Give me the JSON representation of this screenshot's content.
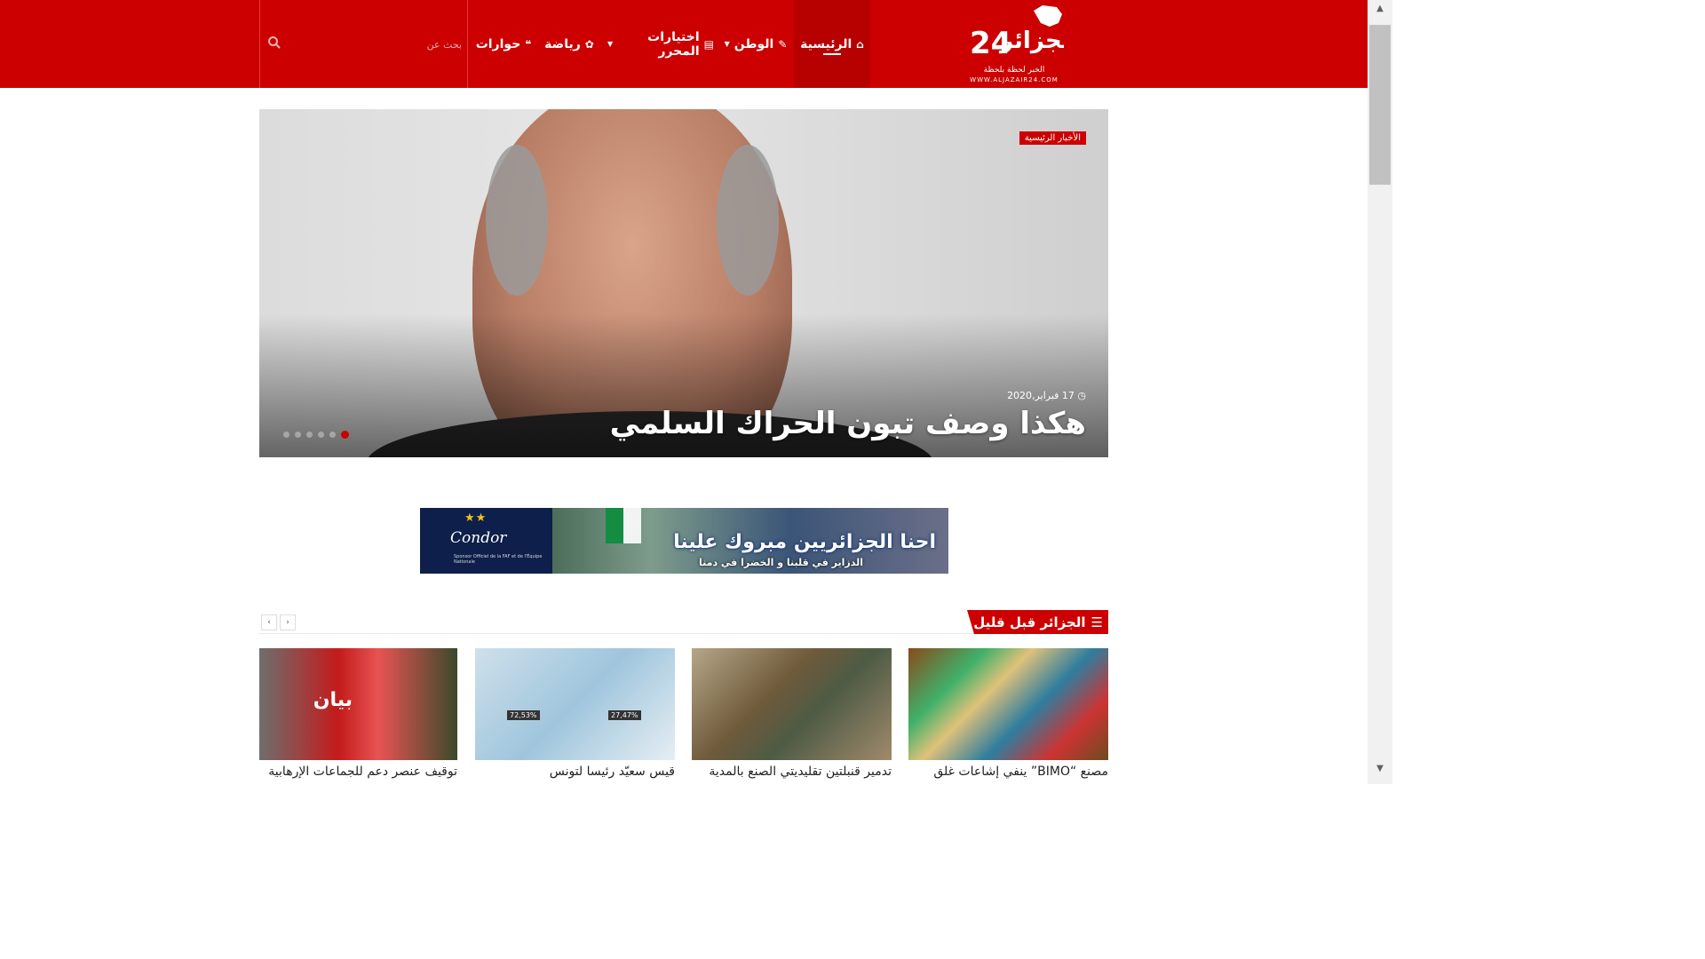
{
  "site": {
    "logo_text": "الجزائر 24",
    "logo_tagline": "الخبر لحظة بلحظة",
    "logo_url": "WWW.ALJAZAIR24.COM"
  },
  "nav": {
    "items": [
      {
        "label": "الرئيسية",
        "icon": "home-icon",
        "active": true
      },
      {
        "label": "الوطن",
        "icon": "edit-icon",
        "dropdown": true
      },
      {
        "label": "اختيارات المحرر",
        "icon": "newspaper-icon",
        "dropdown": true
      },
      {
        "label": "رياضة",
        "icon": "soccer-ball-icon"
      },
      {
        "label": "حوارات",
        "icon": "chat-icon"
      }
    ],
    "search_placeholder": "بحث عن"
  },
  "hero": {
    "category": "الأخبار الرئيسية",
    "date": "17 فبراير,2020",
    "title": "هكذا وصف تبون الحراك السلمي",
    "slides": 6,
    "active_slide": 6
  },
  "ad": {
    "brand": "Condor",
    "brand_sub": "Sponsor Officiel de la FAF et de l'Équipe Nationale",
    "headline": "احنا الجزائريين مبروك علينا",
    "subline": "الدزاير في قلبنا و الخضرا في دمنا"
  },
  "section": {
    "title": "الجزائر قبل قليل",
    "icon": "list-icon"
  },
  "cards": [
    {
      "title": "مصنع “BIMO” ينفي إشاعات غلق"
    },
    {
      "title": "تدمير قنبلتين تقليديتي الصنع بالمدية"
    },
    {
      "title": "قيس سعيّد رئيسا لتونس",
      "left_pct": "72,53%",
      "right_pct": "27,47%"
    },
    {
      "title": "توقيف عنصر دعم للجماعات الإرهابية",
      "badge": "بيان"
    }
  ],
  "colors": {
    "brand_red": "#cc0000",
    "text": "#222222"
  }
}
